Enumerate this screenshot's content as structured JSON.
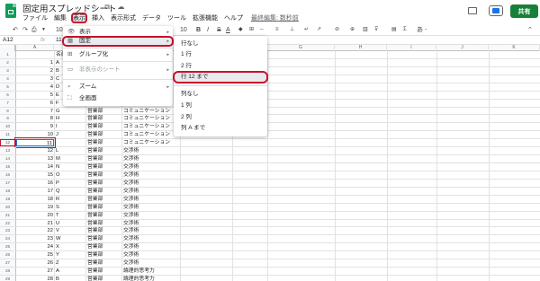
{
  "app": {
    "doc_title": "固定用スプレッドシート",
    "title_icons": "☆ ⧉ ☁",
    "menus": [
      "ファイル",
      "編集",
      "表示",
      "挿入",
      "表示形式",
      "データ",
      "ツール",
      "拡張機能",
      "ヘルプ"
    ],
    "active_menu_index": 2,
    "last_edit": "最終編集: 数秒前",
    "share_label": "共有"
  },
  "toolbar": {
    "undo": "↶",
    "redo": "↷",
    "print": "⎙",
    "paint": "▼",
    "zoom": "10",
    "font_size": "10",
    "bold": "B",
    "italic": "I",
    "strike": "S",
    "text_color": "A",
    "more_right": "あ -",
    "collapse": "⌃"
  },
  "formula_bar": {
    "name_box": "A12",
    "fx": "fx",
    "value": "11"
  },
  "columns": [
    "A",
    "B",
    "C",
    "D",
    "E",
    "F",
    "G",
    "H",
    "I",
    "J",
    "K"
  ],
  "rows": [
    {
      "num": "1",
      "a": "",
      "b": "名前",
      "c": "",
      "d": ""
    },
    {
      "num": "2",
      "a": "1",
      "b": "A",
      "c": "",
      "d": ""
    },
    {
      "num": "3",
      "a": "2",
      "b": "B",
      "c": "",
      "d": ""
    },
    {
      "num": "4",
      "a": "3",
      "b": "C",
      "c": "",
      "d": ""
    },
    {
      "num": "5",
      "a": "4",
      "b": "D",
      "c": "",
      "d": ""
    },
    {
      "num": "6",
      "a": "5",
      "b": "E",
      "c": "",
      "d": ""
    },
    {
      "num": "7",
      "a": "6",
      "b": "F",
      "c": "",
      "d": ""
    },
    {
      "num": "8",
      "a": "7",
      "b": "G",
      "c": "営業部",
      "d": "コミュニケーション"
    },
    {
      "num": "9",
      "a": "8",
      "b": "H",
      "c": "営業部",
      "d": "コミュニケーション"
    },
    {
      "num": "10",
      "a": "9",
      "b": "I",
      "c": "営業部",
      "d": "コミュニケーション"
    },
    {
      "num": "11",
      "a": "10",
      "b": "J",
      "c": "営業部",
      "d": "コミュニケーション"
    },
    {
      "num": "12",
      "a": "11",
      "b": "",
      "c": "営業部",
      "d": "コミュニケーション"
    },
    {
      "num": "13",
      "a": "12",
      "b": "L",
      "c": "営業部",
      "d": "交渉術"
    },
    {
      "num": "14",
      "a": "13",
      "b": "M",
      "c": "営業部",
      "d": "交渉術"
    },
    {
      "num": "15",
      "a": "14",
      "b": "N",
      "c": "営業部",
      "d": "交渉術"
    },
    {
      "num": "16",
      "a": "15",
      "b": "O",
      "c": "営業部",
      "d": "交渉術"
    },
    {
      "num": "17",
      "a": "16",
      "b": "P",
      "c": "営業部",
      "d": "交渉術"
    },
    {
      "num": "18",
      "a": "17",
      "b": "Q",
      "c": "営業部",
      "d": "交渉術"
    },
    {
      "num": "19",
      "a": "18",
      "b": "R",
      "c": "営業部",
      "d": "交渉術"
    },
    {
      "num": "20",
      "a": "19",
      "b": "S",
      "c": "営業部",
      "d": "交渉術"
    },
    {
      "num": "21",
      "a": "20",
      "b": "T",
      "c": "営業部",
      "d": "交渉術"
    },
    {
      "num": "22",
      "a": "21",
      "b": "U",
      "c": "営業部",
      "d": "交渉術"
    },
    {
      "num": "23",
      "a": "22",
      "b": "V",
      "c": "営業部",
      "d": "交渉術"
    },
    {
      "num": "24",
      "a": "23",
      "b": "W",
      "c": "営業部",
      "d": "交渉術"
    },
    {
      "num": "25",
      "a": "24",
      "b": "X",
      "c": "営業部",
      "d": "交渉術"
    },
    {
      "num": "26",
      "a": "25",
      "b": "Y",
      "c": "営業部",
      "d": "交渉術"
    },
    {
      "num": "27",
      "a": "26",
      "b": "Z",
      "c": "営業部",
      "d": "交渉術"
    },
    {
      "num": "28",
      "a": "27",
      "b": "A",
      "c": "営業部",
      "d": "論理的思考力"
    },
    {
      "num": "29",
      "a": "28",
      "b": "B",
      "c": "営業部",
      "d": "論理的思考力"
    }
  ],
  "selected_row_index": 11,
  "view_menu": {
    "items": [
      {
        "label": "表示",
        "icon": "👁",
        "submenu": true,
        "disabled": false
      },
      {
        "label": "固定",
        "icon": "▦",
        "submenu": true,
        "disabled": false,
        "highlighted": true
      },
      {
        "label": "グループ化",
        "icon": "⊞",
        "submenu": true,
        "disabled": false
      },
      {
        "label": "非表示のシート",
        "icon": "▭",
        "submenu": true,
        "disabled": true
      },
      {
        "label": "ズーム",
        "icon": "⌕",
        "submenu": true,
        "disabled": false
      },
      {
        "label": "全画面",
        "icon": "⛶",
        "submenu": false,
        "disabled": false
      }
    ],
    "arrow": "▸"
  },
  "freeze_submenu": {
    "items": [
      "行なし",
      "1 行",
      "2 行",
      "行 12 まで",
      "列なし",
      "1 列",
      "2 列",
      "列 A まで"
    ],
    "highlighted_index": 3
  }
}
